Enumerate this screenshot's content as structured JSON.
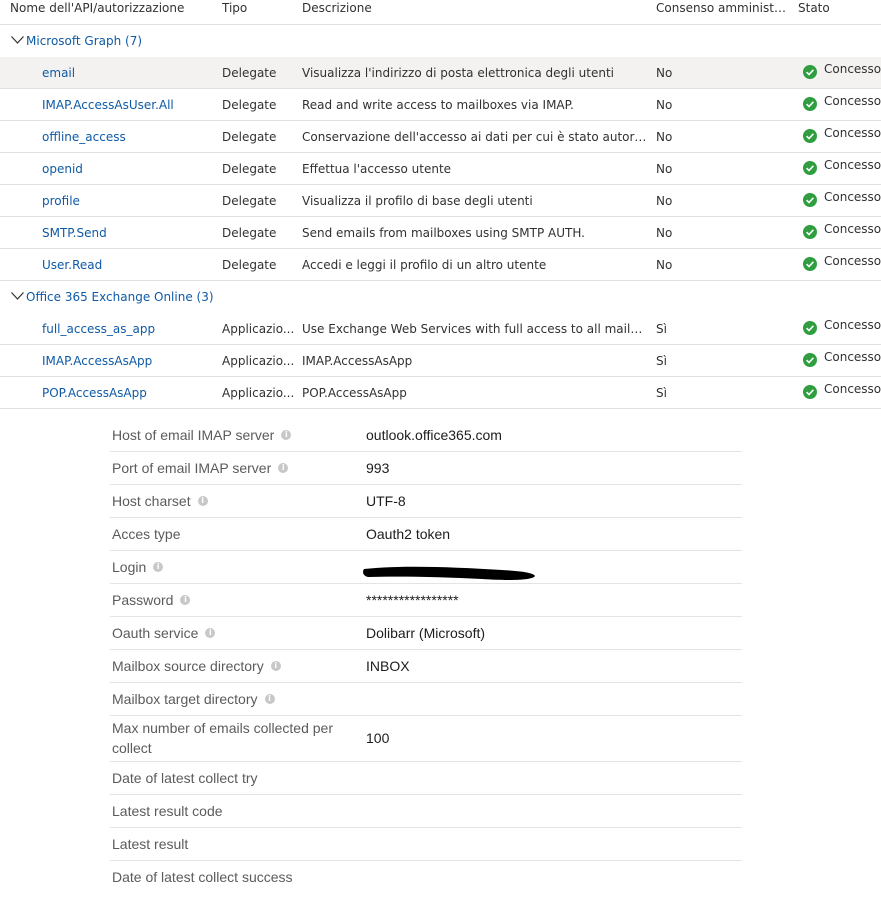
{
  "permissions": {
    "columns": {
      "name": "Nome dell'API/autorizzazione",
      "tipo": "Tipo",
      "desc": "Descrizione",
      "consent": "Consenso amministr...",
      "status": "Stato"
    },
    "groups": [
      {
        "label": "Microsoft Graph (7)"
      },
      {
        "label": "Office 365 Exchange Online (3)"
      }
    ],
    "rows": [
      {
        "name": "email",
        "tipo": "Delegate",
        "desc": "Visualizza l'indirizzo di posta elettronica degli utenti",
        "consent": "No",
        "status": "Concesso p"
      },
      {
        "name": "IMAP.AccessAsUser.All",
        "tipo": "Delegate",
        "desc": "Read and write access to mailboxes via IMAP.",
        "consent": "No",
        "status": "Concesso p"
      },
      {
        "name": "offline_access",
        "tipo": "Delegate",
        "desc": "Conservazione dell'accesso ai dati per cui è stato autorizza...",
        "consent": "No",
        "status": "Concesso p"
      },
      {
        "name": "openid",
        "tipo": "Delegate",
        "desc": "Effettua l'accesso utente",
        "consent": "No",
        "status": "Concesso p"
      },
      {
        "name": "profile",
        "tipo": "Delegate",
        "desc": "Visualizza il profilo di base degli utenti",
        "consent": "No",
        "status": "Concesso p"
      },
      {
        "name": "SMTP.Send",
        "tipo": "Delegate",
        "desc": "Send emails from mailboxes using SMTP AUTH.",
        "consent": "No",
        "status": "Concesso p"
      },
      {
        "name": "User.Read",
        "tipo": "Delegate",
        "desc": "Accedi e leggi il profilo di un altro utente",
        "consent": "No",
        "status": "Concesso p"
      },
      {
        "name": "full_access_as_app",
        "tipo": "Applicazio...",
        "desc": "Use Exchange Web Services with full access to all mailboxes",
        "consent": "Sì",
        "status": "Concesso p"
      },
      {
        "name": "IMAP.AccessAsApp",
        "tipo": "Applicazio...",
        "desc": "IMAP.AccessAsApp",
        "consent": "Sì",
        "status": "Concesso p"
      },
      {
        "name": "POP.AccessAsApp",
        "tipo": "Applicazio...",
        "desc": "POP.AccessAsApp",
        "consent": "Sì",
        "status": "Concesso p"
      }
    ],
    "status_color": "#2e9e3e",
    "link_color": "#0f5aa6"
  },
  "settings": [
    {
      "label": "Host of email IMAP server",
      "value": "outlook.office365.com"
    },
    {
      "label": "Port of email IMAP server",
      "value": "993"
    },
    {
      "label": "Host charset",
      "value": "UTF-8"
    },
    {
      "label": "Acces type",
      "value": "Oauth2 token"
    },
    {
      "label": "Login",
      "value": ""
    },
    {
      "label": "Password",
      "value": "*****************"
    },
    {
      "label": "Oauth service",
      "value": "Dolibarr (Microsoft)"
    },
    {
      "label": "Mailbox source directory",
      "value": "INBOX"
    },
    {
      "label": "Mailbox target directory",
      "value": ""
    },
    {
      "label": "Max number of emails collected per collect",
      "value": "100"
    },
    {
      "label": "Date of latest collect try",
      "value": ""
    },
    {
      "label": "Latest result code",
      "value": ""
    },
    {
      "label": "Latest result",
      "value": ""
    },
    {
      "label": "Date of latest collect success",
      "value": ""
    }
  ]
}
